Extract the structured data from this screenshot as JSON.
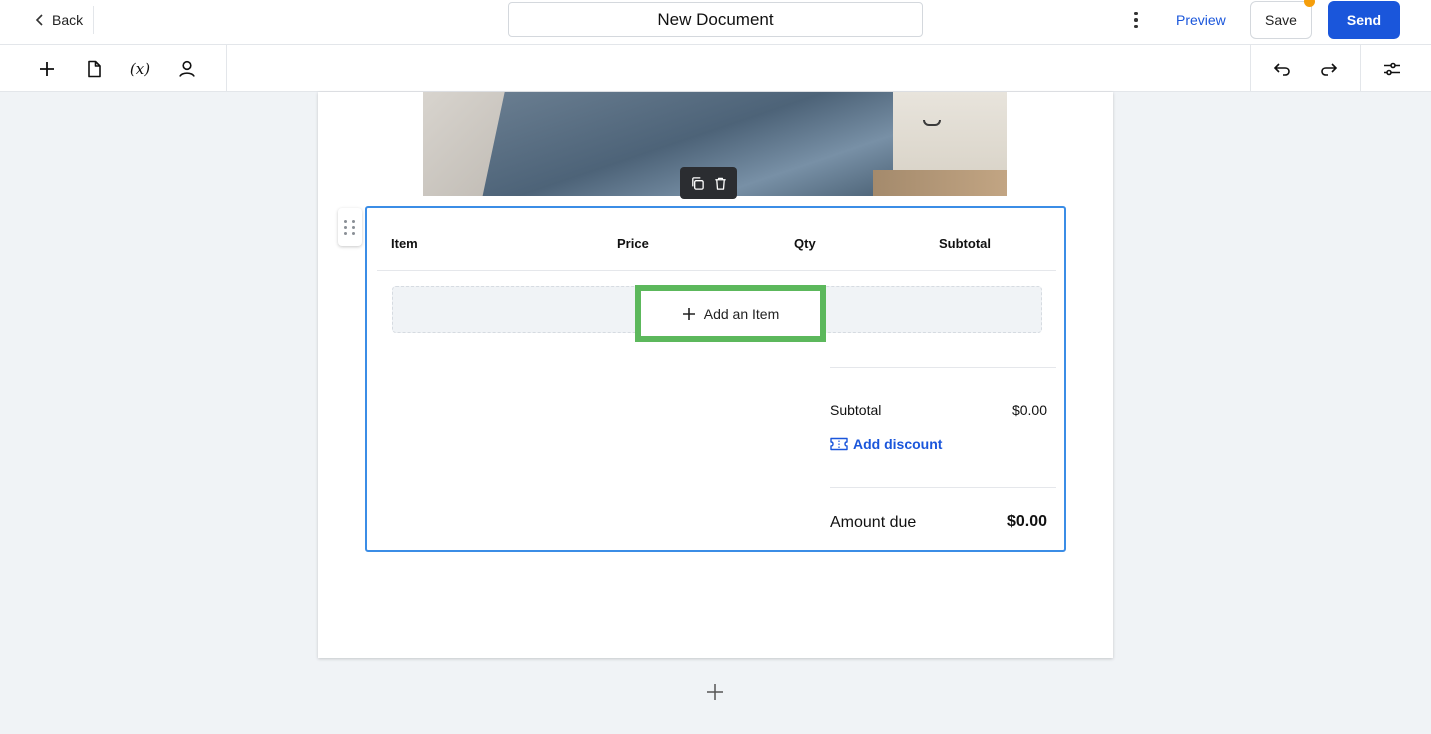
{
  "header": {
    "back_label": "Back",
    "document_title": "New Document",
    "preview_label": "Preview",
    "save_label": "Save",
    "send_label": "Send",
    "save_indicator_color": "#f59e0b",
    "accent_color": "#1a56db"
  },
  "toolbar": {
    "left_tools": [
      {
        "icon": "plus-icon"
      },
      {
        "icon": "document-icon"
      },
      {
        "icon": "variable-icon",
        "glyph": "(x)"
      },
      {
        "icon": "person-icon"
      }
    ],
    "right_tools": [
      {
        "icon": "undo-icon"
      },
      {
        "icon": "redo-icon"
      },
      {
        "icon": "settings-sliders-icon"
      }
    ]
  },
  "block_actions": {
    "icons": [
      "duplicate-icon",
      "trash-icon"
    ]
  },
  "pricing_table": {
    "columns": [
      "Item",
      "Price",
      "Qty",
      "Subtotal"
    ],
    "add_item_label": "Add an Item",
    "subtotal_label": "Subtotal",
    "subtotal_value": "$0.00",
    "add_discount_label": "Add discount",
    "amount_due_label": "Amount due",
    "amount_due_value": "$0.00",
    "selection_color": "#3b8de6",
    "highlight_color": "#5cb85c"
  }
}
